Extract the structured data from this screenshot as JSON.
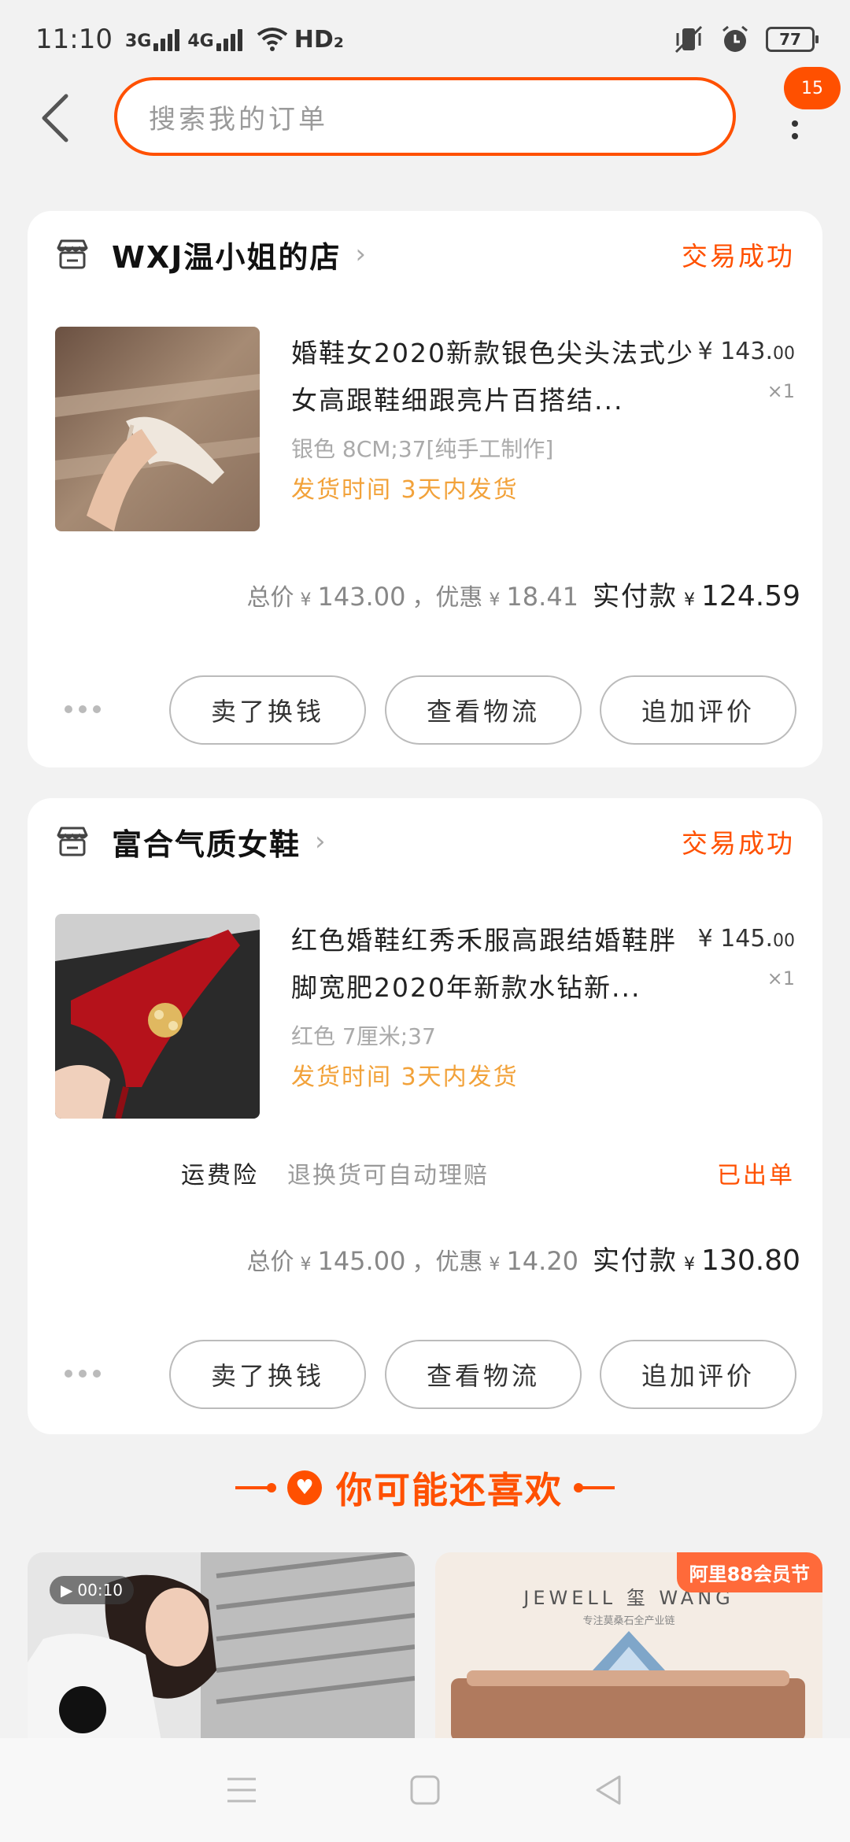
{
  "status_bar": {
    "time": "11:10",
    "network1": "3G",
    "network2": "4G",
    "hd": "HD₂",
    "battery": "77"
  },
  "search": {
    "placeholder": "搜索我的订单"
  },
  "menu_badge": "15",
  "orders": [
    {
      "shop_name": "WXJ温小姐的店",
      "status": "交易成功",
      "item": {
        "title": "婚鞋女2020新款银色尖头法式少女高跟鞋细跟亮片百搭结...",
        "price_yen": "¥",
        "price_int": "143.",
        "price_dec": "00",
        "quantity": "×1",
        "sku": "银色 8CM;37[纯手工制作]",
        "shipping": "发货时间 3天内发货"
      },
      "totals": {
        "total_label": "总价",
        "total_value": "143.00",
        "discount_label": "，优惠",
        "discount_value": "18.41",
        "paid_label": "实付款",
        "paid_value": "124.59"
      },
      "buttons": [
        "卖了换钱",
        "查看物流",
        "追加评价"
      ]
    },
    {
      "shop_name": "富合气质女鞋",
      "status": "交易成功",
      "item": {
        "title": "红色婚鞋红秀禾服高跟结婚鞋胖脚宽肥2020年新款水钻新...",
        "price_yen": "¥",
        "price_int": "145.",
        "price_dec": "00",
        "quantity": "×1",
        "sku": "红色 7厘米;37",
        "shipping": "发货时间 3天内发货"
      },
      "insurance": {
        "label": "运费险",
        "desc": "退换货可自动理赔",
        "status": "已出单"
      },
      "totals": {
        "total_label": "总价",
        "total_value": "145.00",
        "discount_label": "，优惠",
        "discount_value": "14.20",
        "paid_label": "实付款",
        "paid_value": "130.80"
      },
      "buttons": [
        "卖了换钱",
        "查看物流",
        "追加评价"
      ]
    }
  ],
  "recommend": {
    "title": "你可能还喜欢",
    "video_duration": "00:10",
    "promo_label": "阿里88会员节",
    "brand_name": "JEWELL 玺 WANG",
    "brand_sub": "专注莫桑石全产业链"
  },
  "colors": {
    "accent": "#ff5000",
    "shipping": "#f2a23a"
  }
}
